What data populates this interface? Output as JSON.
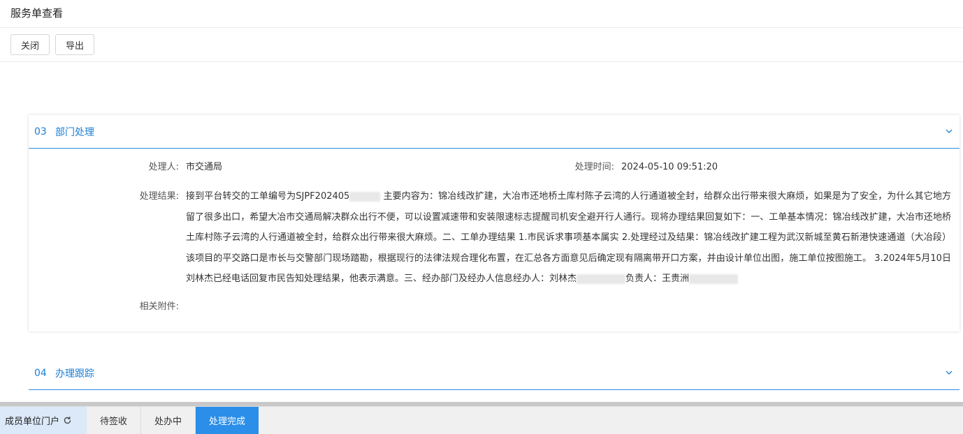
{
  "window": {
    "title": "服务单查看"
  },
  "toolbar": {
    "close_label": "关闭",
    "export_label": "导出"
  },
  "section3": {
    "num": "03",
    "title": "部门处理",
    "handler_label": "处理人:",
    "handler_value": "市交通局",
    "time_label": "处理时间:",
    "time_value": "2024-05-10 09:51:20",
    "result_label": "处理结果:",
    "result_part1": "接到平台转交的工单编号为SJPF202405",
    "result_part2": " 主要内容为：锦冶线改扩建，大冶市还地桥土库村陈子云湾的人行通道被全封，给群众出行带来很大麻烦，如果是为了安全，为什么其它地方留了很多出口，希望大冶市交通局解决群众出行不便，可以设置减速带和安装限速标志提醒司机安全避开行人通行。现将办理结果回复如下：一、工单基本情况：锦冶线改扩建，大冶市还地桥土库村陈子云湾的人行通道被全封，给群众出行带来很大麻烦。二、工单办理结果 1.市民诉求事项基本属实 2.处理经过及结果：锦冶线改扩建工程为武汉新城至黄石新港快速通道（大冶段）该项目的平交路口是市长与交警部门现场踏勘，根据现行的法律法规合理化布置，在汇总各方面意见后确定现有隔离带开口方案，并由设计单位出图，施工单位按图施工。 3.2024年5月10日刘林杰已经电话回复市民告知处理结果，他表示满意。三、经办部门及经办人信息经办人：刘林杰",
    "result_part3": "负责人：王贵洲",
    "attachment_label": "相关附件:"
  },
  "section4": {
    "num": "04",
    "title": "办理跟踪"
  },
  "tabbar": {
    "portal_label": "成员单位门户",
    "tabs": [
      "待签收",
      "处办中",
      "处理完成"
    ],
    "active_color": "#2b8ee8"
  }
}
